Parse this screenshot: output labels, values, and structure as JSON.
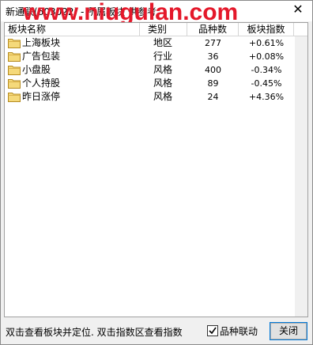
{
  "window": {
    "title": "新通联(603022) - 所属板块 供参考",
    "watermark": "www.niugulan.com"
  },
  "table": {
    "columns": [
      "板块名称",
      "类别",
      "品种数",
      "板块指数"
    ],
    "rows": [
      {
        "name": "上海板块",
        "category": "地区",
        "count": "277",
        "change": "+0.61%"
      },
      {
        "name": "广告包装",
        "category": "行业",
        "count": "36",
        "change": "+0.08%"
      },
      {
        "name": "小盘股",
        "category": "风格",
        "count": "400",
        "change": "-0.34%"
      },
      {
        "name": "个人持股",
        "category": "风格",
        "count": "89",
        "change": "-0.45%"
      },
      {
        "name": "昨日涨停",
        "category": "风格",
        "count": "24",
        "change": "+4.36%"
      }
    ]
  },
  "footer": {
    "hint": "双击查看板块并定位. 双击指数区查看指数",
    "checkbox_label": "品种联动",
    "checkbox_checked": true,
    "close_label": "关闭"
  },
  "colors": {
    "watermark": "#e4182a",
    "folder": "#f5d97a",
    "button_focus": "#0078d7"
  }
}
